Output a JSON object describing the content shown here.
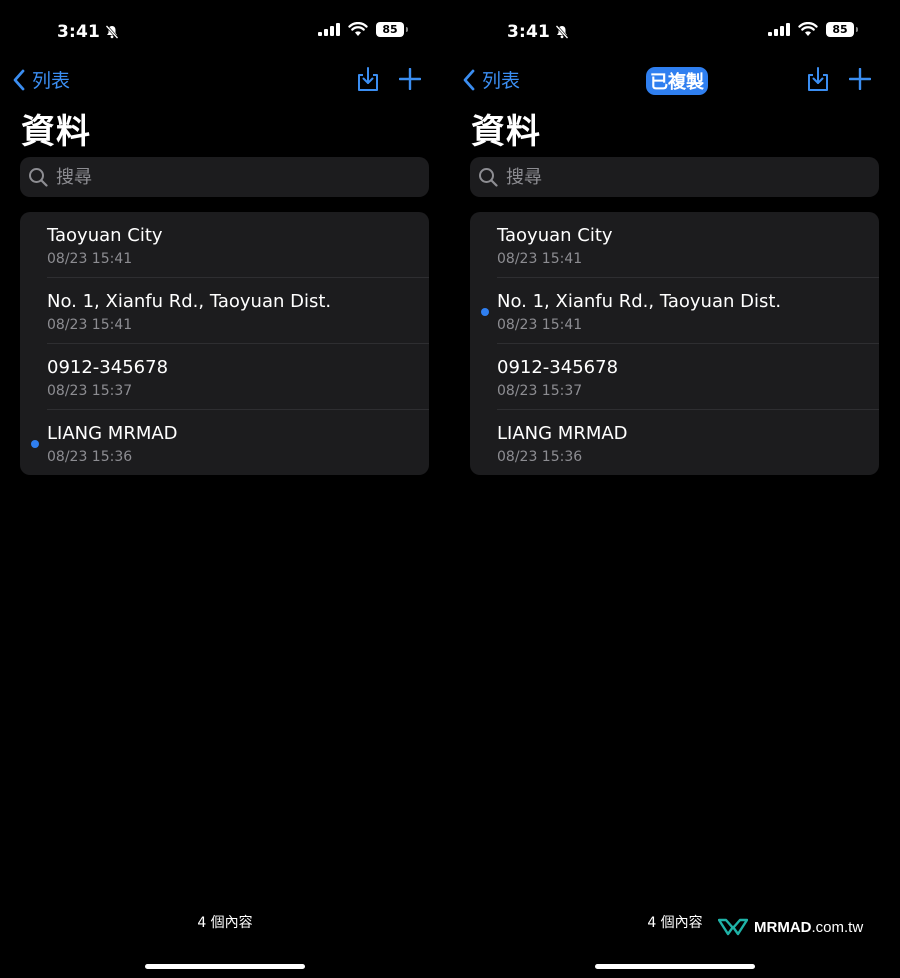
{
  "screens": [
    {
      "status": {
        "time": "3:41",
        "battery": "85"
      },
      "nav": {
        "back_label": "列表",
        "toast": ""
      },
      "title": "資料",
      "search": {
        "placeholder": "搜尋"
      },
      "items": [
        {
          "title": "Taoyuan City",
          "date": "08/23 15:41",
          "selected": false
        },
        {
          "title": "No. 1, Xianfu Rd., Taoyuan Dist.",
          "date": "08/23 15:41",
          "selected": false
        },
        {
          "title": "0912-345678",
          "date": "08/23 15:37",
          "selected": false
        },
        {
          "title": "LIANG MRMAD",
          "date": "08/23 15:36",
          "selected": true
        }
      ],
      "footer": {
        "count": "4 個內容"
      }
    },
    {
      "status": {
        "time": "3:41",
        "battery": "85"
      },
      "nav": {
        "back_label": "列表",
        "toast": "已複製"
      },
      "title": "資料",
      "search": {
        "placeholder": "搜尋"
      },
      "items": [
        {
          "title": "Taoyuan City",
          "date": "08/23 15:41",
          "selected": false
        },
        {
          "title": "No. 1, Xianfu Rd., Taoyuan Dist.",
          "date": "08/23 15:41",
          "selected": true
        },
        {
          "title": "0912-345678",
          "date": "08/23 15:37",
          "selected": false
        },
        {
          "title": "LIANG MRMAD",
          "date": "08/23 15:36",
          "selected": false
        }
      ],
      "footer": {
        "count": "4 個內容"
      }
    }
  ],
  "watermark": {
    "brand": "MRMAD",
    "tld": ".com.tw"
  },
  "colors": {
    "accent": "#2f7ff0",
    "background": "#000000",
    "card": "#1c1c1e",
    "secondary_text": "#8d8d92"
  },
  "icons": {
    "back": "chevron-left-icon",
    "import": "tray-download-icon",
    "add": "plus-icon",
    "search": "magnifying-glass-icon",
    "mute": "bell-slash-icon",
    "signal": "cellular-signal-icon",
    "wifi": "wifi-icon"
  }
}
